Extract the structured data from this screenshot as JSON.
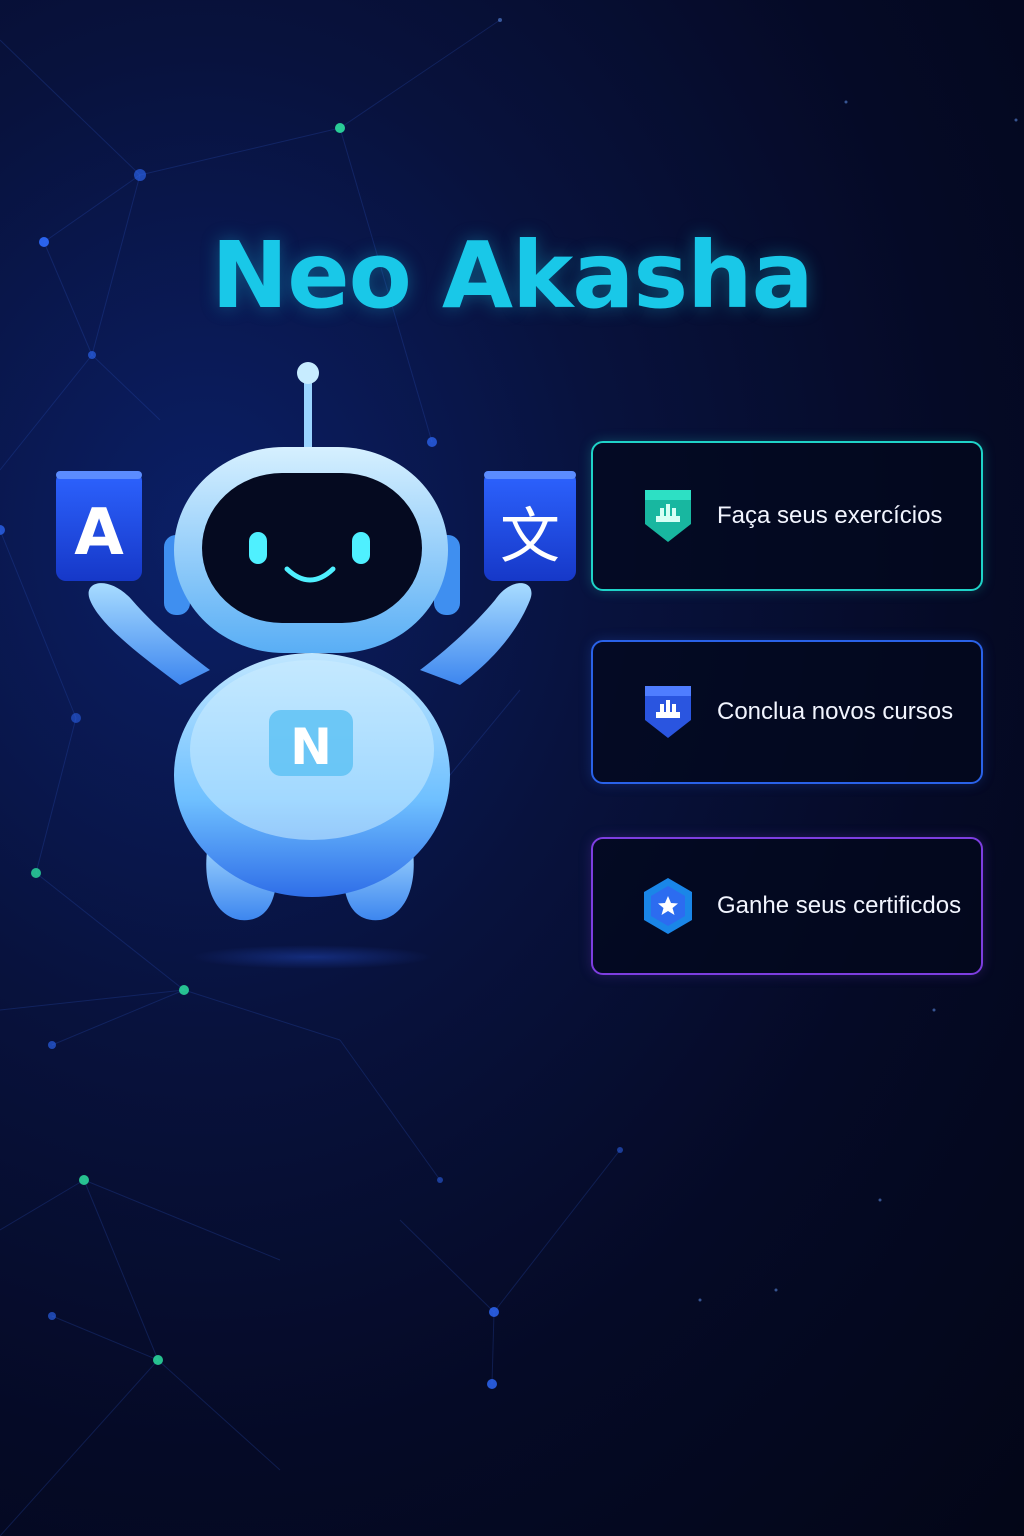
{
  "app": {
    "title": "Neo Akasha"
  },
  "colors": {
    "title": "#19c8e8",
    "card_teal": "#1fd3c8",
    "card_blue": "#2a62e8",
    "card_purple": "#7d3ee0",
    "robot_body": "#7cc8ff",
    "robot_accent": "#2a5be8"
  },
  "mascot": {
    "chest_letter": "N",
    "left_tile": {
      "text": "A",
      "icon": "latin-letter-icon"
    },
    "right_tile": {
      "text": "文",
      "icon": "chinese-character-icon"
    }
  },
  "menu": {
    "items": [
      {
        "label": "Faça seus exercícios",
        "icon": "shield-badge-icon",
        "accent": "#1fd3c8"
      },
      {
        "label": "Conclua novos cursos",
        "icon": "shield-badge-icon",
        "accent": "#2a62e8"
      },
      {
        "label": "Ganhe seus certificdos",
        "icon": "hexagon-star-icon",
        "accent": "#7d3ee0"
      }
    ]
  }
}
